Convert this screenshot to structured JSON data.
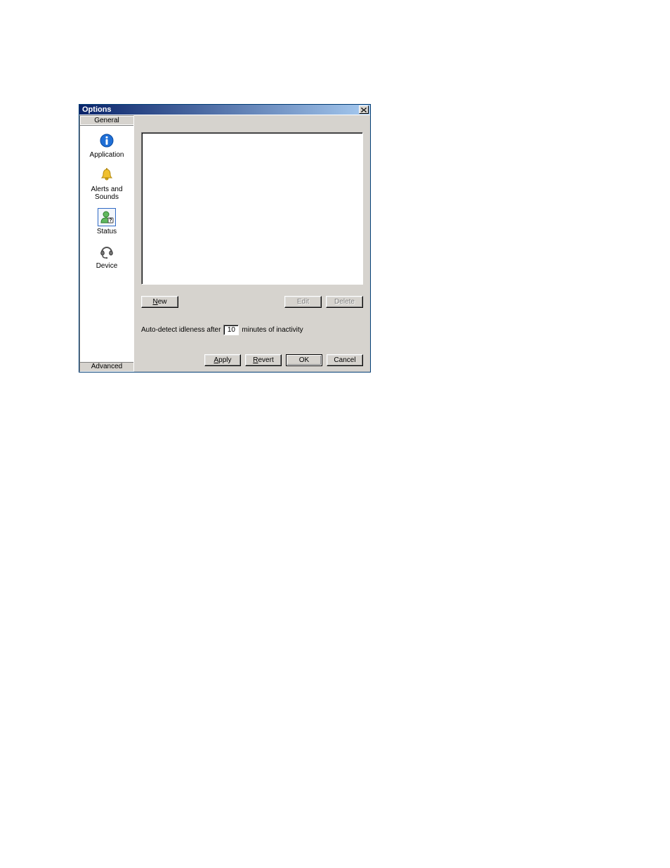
{
  "window": {
    "title": "Options"
  },
  "sidebar": {
    "group_general": "General",
    "group_advanced": "Advanced",
    "items": [
      {
        "label": "Application",
        "icon": "info"
      },
      {
        "label": "Alerts and Sounds",
        "icon": "bell"
      },
      {
        "label": "Status",
        "icon": "person"
      },
      {
        "label": "Device",
        "icon": "headset"
      }
    ]
  },
  "list_buttons": {
    "new": "New",
    "edit": "Edit",
    "delete": "Delete"
  },
  "idle": {
    "prefix": "Auto-detect idleness after",
    "value": "10",
    "suffix": "minutes of inactivity"
  },
  "dialog_buttons": {
    "apply": "pply",
    "apply_u": "A",
    "revert": "evert",
    "revert_u": "R",
    "ok": "OK",
    "cancel": "Cancel"
  }
}
